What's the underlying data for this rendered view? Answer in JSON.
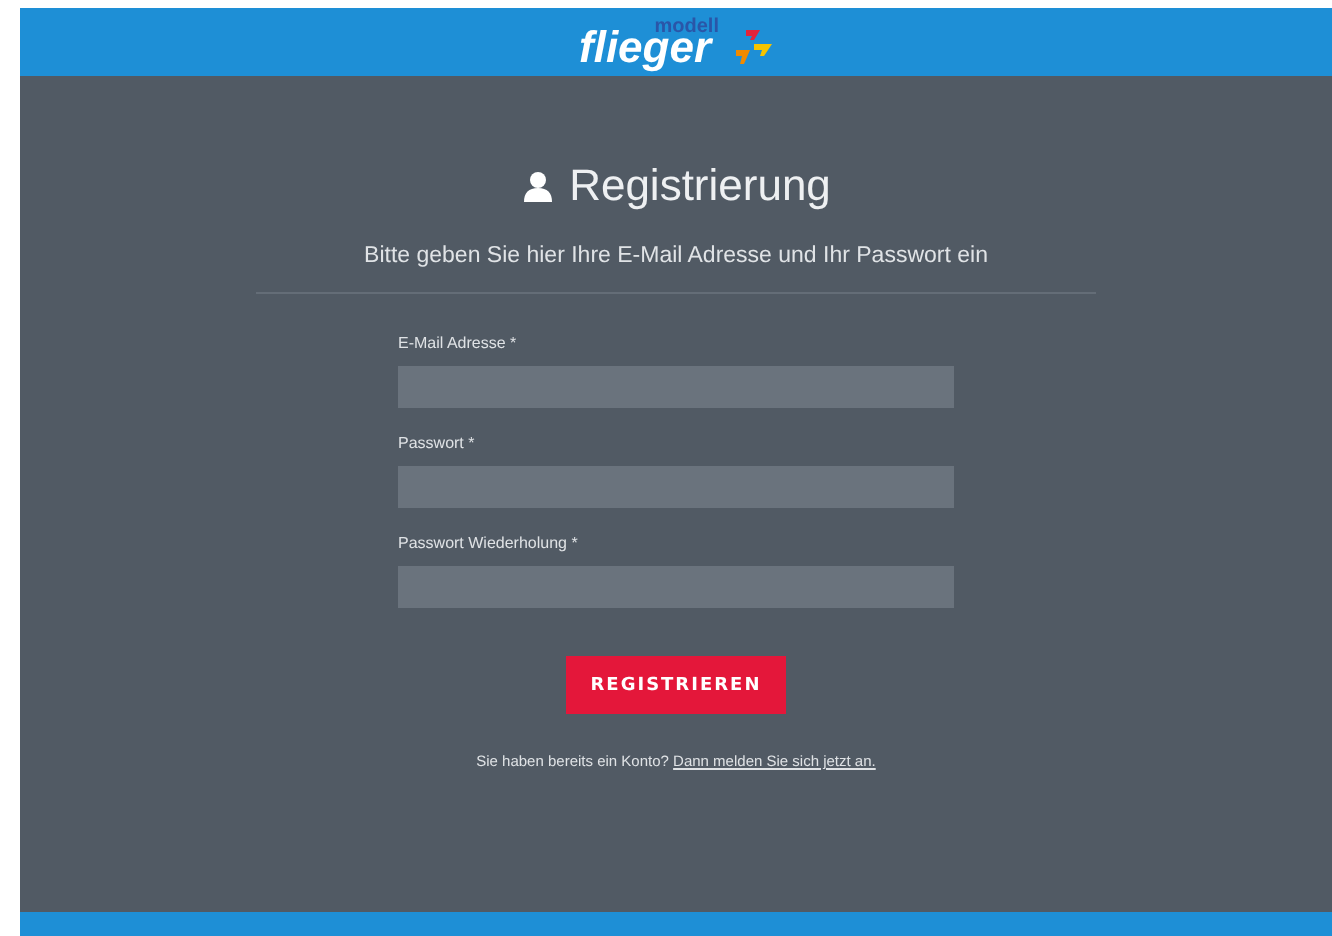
{
  "header": {
    "logo_small": "modell",
    "logo_main": "flieger"
  },
  "form": {
    "title": "Registrierung",
    "subtitle": "Bitte geben Sie hier Ihre E-Mail Adresse und Ihr Passwort ein",
    "fields": [
      {
        "label": "E-Mail Adresse",
        "required_mark": "*"
      },
      {
        "label": "Passwort",
        "required_mark": "*"
      },
      {
        "label": "Passwort Wiederholung",
        "required_mark": "*"
      }
    ],
    "submit": "REGISTRIEREN",
    "login_prompt": "Sie haben bereits ein Konto?",
    "login_link": "Dann melden Sie sich jetzt an."
  }
}
